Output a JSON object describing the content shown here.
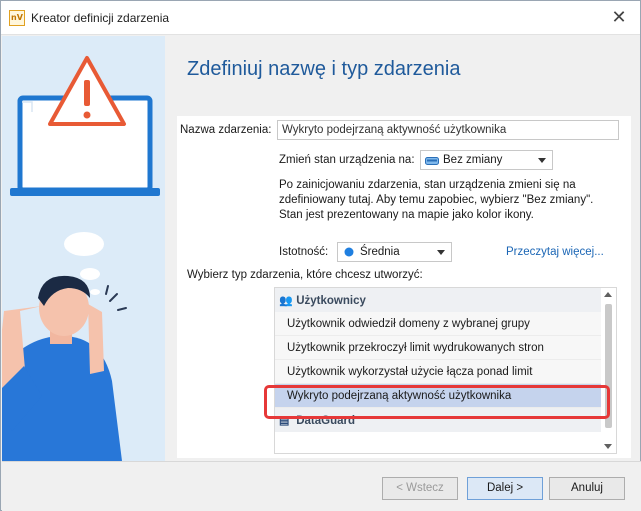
{
  "window": {
    "title": "Kreator definicji zdarzenia",
    "app_icon_text": "nV"
  },
  "heading": "Zdefiniuj nazwę i typ zdarzenia",
  "form": {
    "name_label": "Nazwa zdarzenia:",
    "name_value": "Wykryto podejrzaną aktywność użytkownika",
    "state_label": "Zmień stan urządzenia na:",
    "state_value": "Bez zmiany",
    "info_text": "Po zainicjowaniu zdarzenia, stan urządzenia zmieni się na zdefiniowany tutaj. Aby temu zapobiec, wybierz \"Bez zmiany\". Stan jest prezentowany na mapie jako kolor ikony.",
    "severity_label": "Istotność:",
    "severity_value": "Średnia",
    "severity_color": "#1f7fe0",
    "read_more_link": "Przeczytaj więcej...",
    "type_prompt": "Wybierz typ zdarzenia, które chcesz utworzyć:"
  },
  "event_list": {
    "groups": [
      {
        "name": "Użytkownicy",
        "icon": "users-icon",
        "items": [
          "Użytkownik odwiedził domeny z wybranej grupy",
          "Użytkownik przekroczył limit wydrukowanych stron",
          "Użytkownik wykorzystał użycie łącza ponad limit",
          "Wykryto podejrzaną aktywność użytkownika"
        ]
      },
      {
        "name": "DataGuard",
        "icon": "dataguard-icon",
        "items": []
      }
    ],
    "selected": "Wykryto podejrzaną aktywność użytkownika",
    "highlight_color": "#e63838"
  },
  "buttons": {
    "back": "< Wstecz",
    "next": "Dalej >",
    "cancel": "Anuluj"
  }
}
